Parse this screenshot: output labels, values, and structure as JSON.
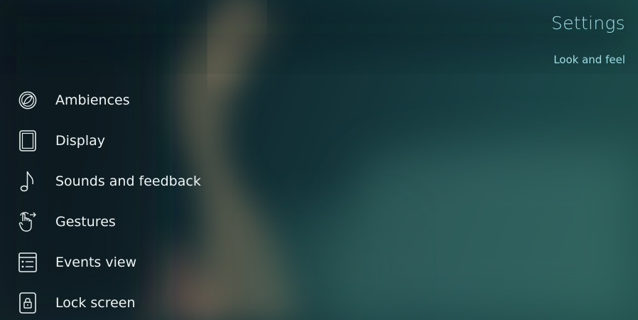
{
  "header": {
    "title": "Settings",
    "section": "Look and feel"
  },
  "menu": {
    "items": [
      {
        "label": "Ambiences",
        "icon": "ambiences-icon"
      },
      {
        "label": "Display",
        "icon": "display-icon"
      },
      {
        "label": "Sounds and feedback",
        "icon": "music-note-icon"
      },
      {
        "label": "Gestures",
        "icon": "gesture-icon"
      },
      {
        "label": "Events view",
        "icon": "events-view-icon"
      },
      {
        "label": "Lock screen",
        "icon": "lock-icon"
      }
    ]
  },
  "colors": {
    "accent": "#9fdde6",
    "text": "#eef3f4",
    "background": "#0c1d22"
  }
}
